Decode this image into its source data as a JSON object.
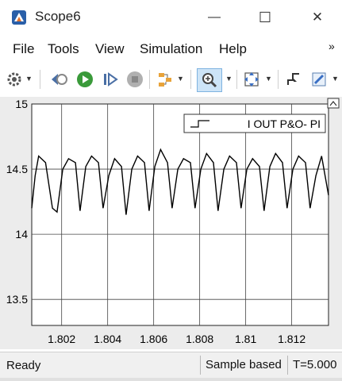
{
  "window": {
    "title": "Scope6",
    "minimize_glyph": "—",
    "maximize_glyph": "☐",
    "close_glyph": "✕"
  },
  "menu": {
    "items": [
      "File",
      "Tools",
      "View",
      "Simulation",
      "Help"
    ],
    "overflow_glyph": "»"
  },
  "toolbar": {
    "buttons": [
      "settings-icon",
      "step-back-icon",
      "run-icon",
      "step-forward-icon",
      "stop-icon",
      "highlight-icon",
      "zoom-in-icon",
      "autoscale-icon",
      "triggers-icon",
      "edit-icon"
    ]
  },
  "chart_data": {
    "type": "line",
    "xlim": [
      1.8007,
      1.8136
    ],
    "ylim": [
      13.3,
      15.0
    ],
    "x_ticks": [
      "1.802",
      "1.804",
      "1.806",
      "1.808",
      "1.81",
      "1.812"
    ],
    "y_ticks": [
      "15",
      "14.5",
      "14",
      "13.5"
    ],
    "grid": true,
    "legend_position": "top-right",
    "series": [
      {
        "name": "I OUT P&O- PI",
        "color": "#000000",
        "x": [
          1.8007,
          1.80085,
          1.801,
          1.8013,
          1.8016,
          1.8018,
          1.80205,
          1.8023,
          1.8026,
          1.8028,
          1.80305,
          1.8033,
          1.8036,
          1.8038,
          1.80405,
          1.8043,
          1.8046,
          1.8048,
          1.80505,
          1.8053,
          1.8056,
          1.8058,
          1.80605,
          1.8063,
          1.8066,
          1.8068,
          1.80705,
          1.8073,
          1.8076,
          1.8078,
          1.80805,
          1.8083,
          1.8086,
          1.8088,
          1.80905,
          1.8093,
          1.8096,
          1.8098,
          1.81005,
          1.8103,
          1.8106,
          1.8108,
          1.81105,
          1.8113,
          1.8116,
          1.8118,
          1.81205,
          1.8123,
          1.8126,
          1.8128,
          1.81305,
          1.8133,
          1.8136
        ],
        "y": [
          14.2,
          14.45,
          14.6,
          14.55,
          14.2,
          14.17,
          14.5,
          14.58,
          14.55,
          14.18,
          14.52,
          14.6,
          14.55,
          14.2,
          14.45,
          14.58,
          14.52,
          14.15,
          14.5,
          14.6,
          14.55,
          14.18,
          14.52,
          14.65,
          14.55,
          14.2,
          14.5,
          14.58,
          14.55,
          14.2,
          14.5,
          14.62,
          14.55,
          14.18,
          14.5,
          14.6,
          14.55,
          14.2,
          14.5,
          14.58,
          14.52,
          14.18,
          14.52,
          14.62,
          14.55,
          14.2,
          14.5,
          14.6,
          14.55,
          14.2,
          14.45,
          14.6,
          14.3
        ]
      }
    ]
  },
  "status": {
    "left": "Ready",
    "mode": "Sample based",
    "time": "T=5.000"
  }
}
